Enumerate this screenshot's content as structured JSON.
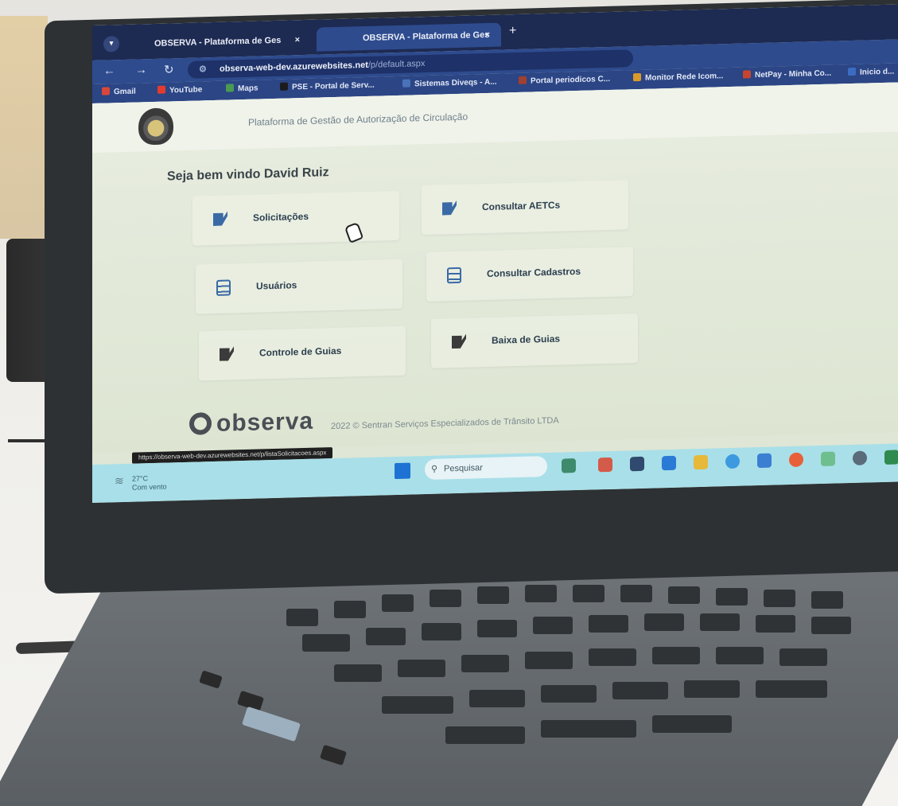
{
  "browser": {
    "tabs": [
      {
        "label": "OBSERVA - Plataforma de Ges",
        "close": "×"
      },
      {
        "label": "OBSERVA - Plataforma de Ges",
        "close": "×"
      }
    ],
    "new_tab": "+",
    "url_main": "observa-web-dev.azurewebsites.net",
    "url_rest": "/p/default.aspx",
    "bookmarks": [
      {
        "label": "Gmail",
        "color": "#d8473a"
      },
      {
        "label": "YouTube",
        "color": "#e33b2e"
      },
      {
        "label": "Maps",
        "color": "#4a9a52"
      },
      {
        "label": "PSE - Portal de Serv...",
        "color": "#1b1b1b"
      },
      {
        "label": "Sistemas Diveqs - A...",
        "color": "#4a72b8"
      },
      {
        "label": "Portal periodicos C...",
        "color": "#a04030"
      },
      {
        "label": "Monitor Rede Icom...",
        "color": "#d99a2b"
      },
      {
        "label": "NetPay - Minha Co...",
        "color": "#c7452f"
      },
      {
        "label": "Inicio d...",
        "color": "#3b6cc2"
      }
    ]
  },
  "page": {
    "app_title": "Plataforma de Gestão de Autorização de Circulação",
    "welcome": "Seja bem vindo David Ruiz",
    "menu": [
      {
        "label": "Solicitações",
        "icon": "edit-icon"
      },
      {
        "label": "Consultar AETCs",
        "icon": "edit-icon"
      },
      {
        "label": "Usuários",
        "icon": "document-icon"
      },
      {
        "label": "Consultar Cadastros",
        "icon": "document-icon"
      },
      {
        "label": "Controle de Guias",
        "icon": "edit-icon"
      },
      {
        "label": "Baixa de Guias",
        "icon": "edit-icon"
      }
    ],
    "logo": "observa",
    "copyright": "2022 © Sentran Serviços Especializados de Trânsito LTDA"
  },
  "status_url": "https://observa-web-dev.azurewebsites.net/p/listaSolicitacoes.aspx",
  "taskbar": {
    "temperature": "27°C",
    "weather_text": "Com vento",
    "search_placeholder": "Pesquisar"
  }
}
